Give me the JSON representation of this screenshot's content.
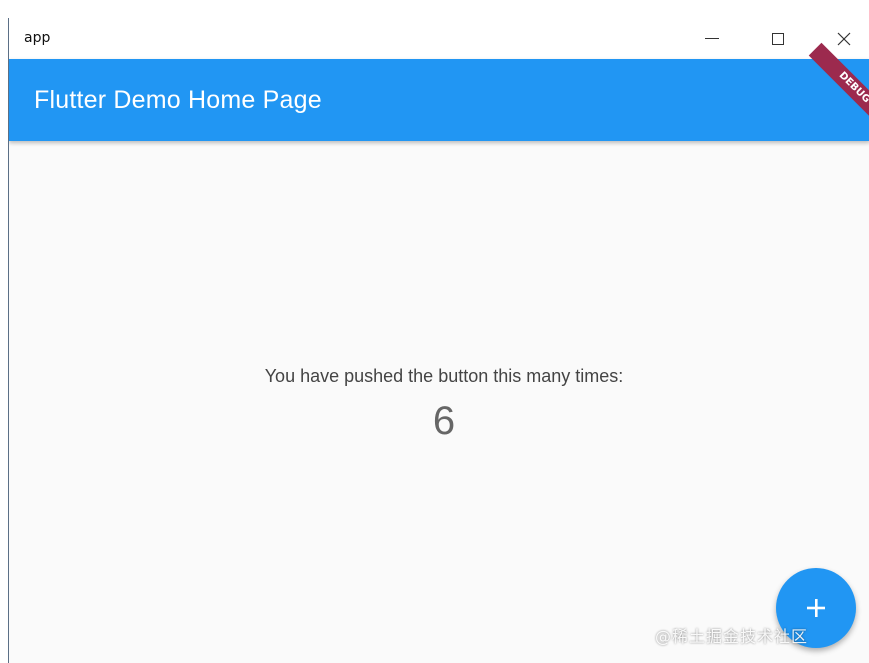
{
  "window": {
    "title": "app"
  },
  "appbar": {
    "title": "Flutter Demo Home Page",
    "color": "#2196f3",
    "debug_label": "DEBUG"
  },
  "body": {
    "message": "You have pushed the button this many times:",
    "counter": "6"
  },
  "fab": {
    "icon": "plus-icon"
  },
  "watermark": {
    "text": "@稀土掘金技术社区"
  }
}
